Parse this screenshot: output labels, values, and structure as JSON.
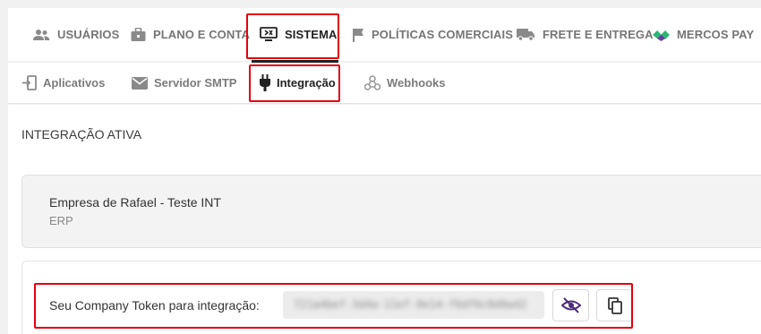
{
  "top_tabs": [
    {
      "label": "USUÁRIOS",
      "icon": "users-icon"
    },
    {
      "label": "PLANO E CONTA",
      "icon": "briefcase-icon"
    },
    {
      "label": "SISTEMA",
      "icon": "system-monitor-icon",
      "active": true
    },
    {
      "label": "POLÍTICAS COMERCIAIS",
      "icon": "flag-icon"
    },
    {
      "label": "FRETE E ENTREGA",
      "icon": "truck-icon"
    },
    {
      "label": "MERCOS PAY",
      "icon": "mercos-pay-logo-icon"
    }
  ],
  "sub_tabs": [
    {
      "label": "Aplicativos",
      "icon": "app-login-icon"
    },
    {
      "label": "Servidor SMTP",
      "icon": "mail-icon"
    },
    {
      "label": "Integração",
      "icon": "plug-icon",
      "active": true
    },
    {
      "label": "Webhooks",
      "icon": "webhook-icon"
    }
  ],
  "section": {
    "title": "INTEGRAÇÃO ATIVA"
  },
  "integration": {
    "company": "Empresa de Rafael - Teste INT",
    "type": "ERP"
  },
  "token": {
    "label": "Seu Company Token para integração:",
    "value": "721a4bef-3d4a-11ef-8e14-f6df6c0d0a42",
    "toggle_icon": "eye-slash-icon",
    "copy_icon": "copy-icon"
  },
  "colors": {
    "highlight": "#e3000f",
    "active_text": "#222222",
    "inactive_text": "#757575",
    "mercos_green": "#2bb673",
    "mercos_purple": "#6b3fa0"
  }
}
